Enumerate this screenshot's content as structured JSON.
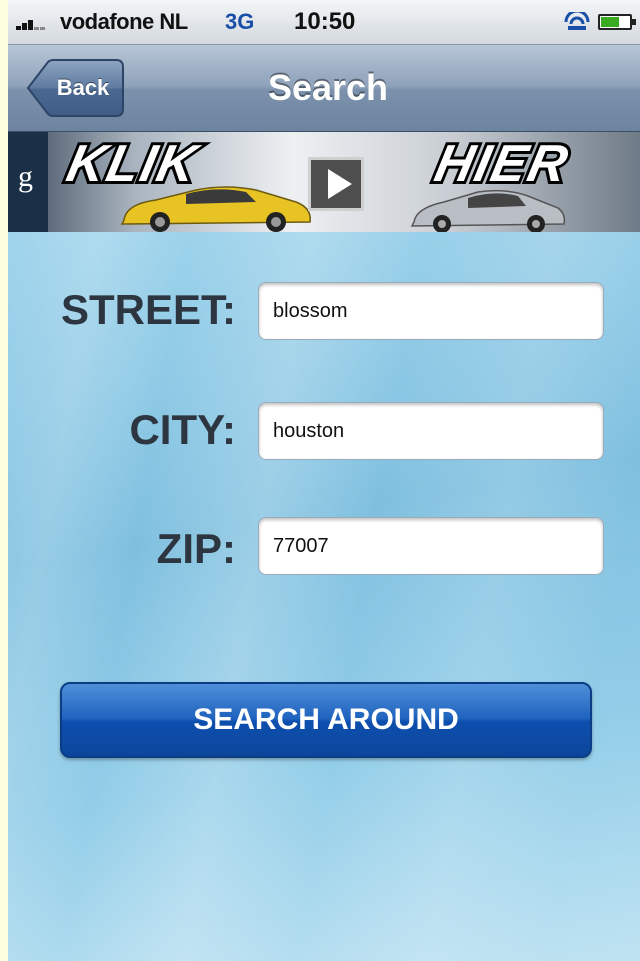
{
  "status_bar": {
    "carrier": "vodafone NL",
    "network": "3G",
    "time": "10:50"
  },
  "nav": {
    "back_label": "Back",
    "title": "Search"
  },
  "ad": {
    "g_icon": "g",
    "text_left": "KLIK",
    "text_right": "HIER",
    "play_icon": "play-icon"
  },
  "form": {
    "street": {
      "label": "STREET:",
      "value": "blossom"
    },
    "city": {
      "label": "CITY:",
      "value": "houston"
    },
    "zip": {
      "label": "ZIP:",
      "value": "77007"
    },
    "submit_label": "SEARCH AROUND"
  },
  "colors": {
    "nav_bar": "#7b91ac",
    "button_blue": "#1f63bf",
    "background_blue": "#8cc8e4"
  }
}
